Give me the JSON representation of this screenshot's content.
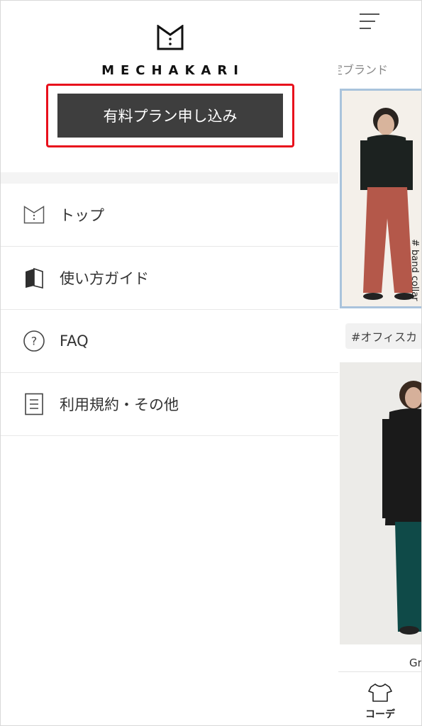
{
  "background": {
    "brand_partial": "定ブランド",
    "card_tag": "# band collar",
    "tag_chip": "#オフィスカ",
    "card_caption_partial": "Gr",
    "tab_label": "コーデ"
  },
  "drawer": {
    "logo_text": "MECHAKARI",
    "subscribe_label": "有料プラン申し込み",
    "menu": [
      {
        "label": "トップ",
        "icon": "logo-icon"
      },
      {
        "label": "使い方ガイド",
        "icon": "book-icon"
      },
      {
        "label": "FAQ",
        "icon": "question-circle-icon"
      },
      {
        "label": "利用規約・その他",
        "icon": "document-icon"
      }
    ]
  },
  "colors": {
    "highlight": "#e8101c",
    "button_bg": "#3e3e3e",
    "card_border": "#a9c3dc"
  }
}
